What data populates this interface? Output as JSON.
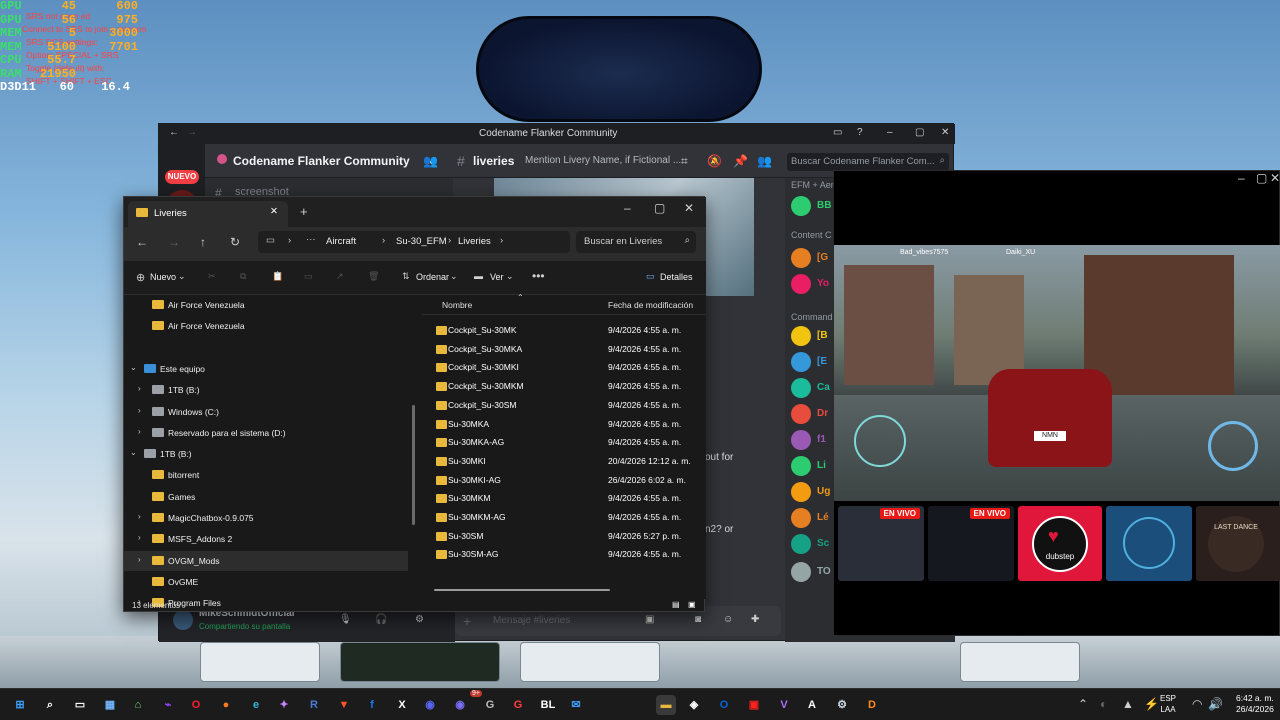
{
  "overlay": {
    "rows": [
      {
        "label": "GPU",
        "v1": "45",
        "v2": "600"
      },
      {
        "label": "GPU",
        "v1": "56",
        "v2": "975"
      },
      {
        "label": "MEM",
        "v1": "5",
        "v2": "3000"
      },
      {
        "label": "MEM",
        "v1": "5100",
        "v2": "7701"
      },
      {
        "label": "CPU",
        "v1": "55.7",
        "v2": ""
      },
      {
        "label": "RAM",
        "v1": "21950",
        "v2": ""
      }
    ],
    "fps_row": {
      "label": "D3D11",
      "fps": "60",
      "frametime": "16.4"
    },
    "dcs_lines": [
      "SRS not conn ed",
      "Connect to SRS to join a mission",
      "SRS DCS settings:",
      "Option: SPECIAL + SRS",
      "Toggle (default) with:",
      "SHIFT + SHIFT + ESC"
    ]
  },
  "discord": {
    "window_title": "Codename Flanker Community",
    "nuevo_badge": "NUEVO",
    "server_name": "Codename Flanker Community",
    "channel_name": "liveries",
    "channel_topic": "Mention Livery Name, if Fictional ...",
    "search_placeholder": "Buscar Codename Flanker Com...",
    "sidebar_channel": "screenshot",
    "member_categories": [
      "EFM + Aero",
      "Content C",
      "Command"
    ],
    "members": [
      "BB",
      "[G",
      "Yo",
      "[B",
      "[E",
      "Ca",
      "Dr",
      "f1",
      "Li",
      "Ug",
      "Lé",
      "Sc",
      "TO"
    ],
    "message_fragments": [
      "out for",
      "n2? or"
    ],
    "input_placeholder": "Mensaje #liveries",
    "user_name": "MikeSchmidtOfficial",
    "user_status": "Compartiendo su pantalla"
  },
  "stream": {
    "hud_names": [
      "Bad_vibes7575",
      "Daiki_XU"
    ],
    "plate": "NMN",
    "thumbnails": [
      {
        "live": "EN VIVO",
        "color": "#2a2e38"
      },
      {
        "live": "EN VIVO",
        "color": "#15181f"
      },
      {
        "text": "dubstep",
        "color": "#e0163a"
      },
      {
        "color": "#1b4e7a"
      },
      {
        "text": "LAST DANCE",
        "color": "#2a1f1c"
      }
    ]
  },
  "explorer": {
    "tab_title": "Liveries",
    "path": [
      "Aircraft",
      "Su-30_EFM",
      "Liveries"
    ],
    "search_placeholder": "Buscar en Liveries",
    "toolbar": {
      "new": "Nuevo",
      "sort": "Ordenar",
      "view": "Ver",
      "details": "Detalles"
    },
    "nav": [
      {
        "label": "Air Force Venezuela",
        "indent": 1,
        "icon": "folder",
        "chev": ""
      },
      {
        "label": "Air Force Venezuela",
        "indent": 1,
        "icon": "folder",
        "chev": ""
      },
      {
        "label": "",
        "indent": 0,
        "icon": "",
        "chev": ""
      },
      {
        "label": "Este equipo",
        "indent": 0,
        "icon": "pc",
        "chev": "⌄"
      },
      {
        "label": "1TB (B:)",
        "indent": 1,
        "icon": "drive",
        "chev": "›"
      },
      {
        "label": "Windows (C:)",
        "indent": 1,
        "icon": "drive",
        "chev": "›"
      },
      {
        "label": "Reservado para el sistema (D:)",
        "indent": 1,
        "icon": "drive",
        "chev": "›"
      },
      {
        "label": "1TB (B:)",
        "indent": 0,
        "icon": "drive",
        "chev": "⌄"
      },
      {
        "label": "bitorrent",
        "indent": 1,
        "icon": "folder",
        "chev": ""
      },
      {
        "label": "Games",
        "indent": 1,
        "icon": "folder",
        "chev": ""
      },
      {
        "label": "MagicChatbox-0.9.075",
        "indent": 1,
        "icon": "folder",
        "chev": "›"
      },
      {
        "label": "MSFS_Addons 2",
        "indent": 1,
        "icon": "folder",
        "chev": "›"
      },
      {
        "label": "OVGM_Mods",
        "indent": 1,
        "icon": "folder",
        "chev": "›",
        "selected": true
      },
      {
        "label": "OvGME",
        "indent": 1,
        "icon": "folder",
        "chev": ""
      },
      {
        "label": "Program Files",
        "indent": 1,
        "icon": "folder",
        "chev": "›"
      }
    ],
    "columns": {
      "name": "Nombre",
      "date": "Fecha de modificación"
    },
    "files": [
      {
        "name": "Cockpit_Su-30MK",
        "date": "9/4/2026 4:55 a. m."
      },
      {
        "name": "Cockpit_Su-30MKA",
        "date": "9/4/2026 4:55 a. m."
      },
      {
        "name": "Cockpit_Su-30MKI",
        "date": "9/4/2026 4:55 a. m."
      },
      {
        "name": "Cockpit_Su-30MKM",
        "date": "9/4/2026 4:55 a. m."
      },
      {
        "name": "Cockpit_Su-30SM",
        "date": "9/4/2026 4:55 a. m."
      },
      {
        "name": "Su-30MKA",
        "date": "9/4/2026 4:55 a. m."
      },
      {
        "name": "Su-30MKA-AG",
        "date": "9/4/2026 4:55 a. m."
      },
      {
        "name": "Su-30MKI",
        "date": "20/4/2026 12:12 a. m."
      },
      {
        "name": "Su-30MKI-AG",
        "date": "26/4/2026 6:02 a. m."
      },
      {
        "name": "Su-30MKM",
        "date": "9/4/2026 4:55 a. m."
      },
      {
        "name": "Su-30MKM-AG",
        "date": "9/4/2026 4:55 a. m."
      },
      {
        "name": "Su-30SM",
        "date": "9/4/2026 5:27 p. m."
      },
      {
        "name": "Su-30SM-AG",
        "date": "9/4/2026 4:55 a. m."
      }
    ],
    "status": "13 elementos"
  },
  "taskbar": {
    "lang": [
      "ESP",
      "LAA"
    ],
    "time": "6:42 a. m.",
    "date": "26/4/2026",
    "badge": "9+",
    "apps": [
      {
        "name": "start-icon",
        "glyph": "⊞",
        "color": "#3aa0ff"
      },
      {
        "name": "search-icon",
        "glyph": "⌕",
        "color": "#ffffff"
      },
      {
        "name": "task-view-icon",
        "glyph": "▭",
        "color": "#ffffff"
      },
      {
        "name": "widgets-icon",
        "glyph": "▦",
        "color": "#6fb6ff"
      },
      {
        "name": "app-icon",
        "glyph": "⌂",
        "color": "#7ad67a"
      },
      {
        "name": "twitch-icon",
        "glyph": "⌁",
        "color": "#9146ff"
      },
      {
        "name": "opera-icon",
        "glyph": "O",
        "color": "#ff1b2d"
      },
      {
        "name": "firefox-icon",
        "glyph": "●",
        "color": "#ff7b1c"
      },
      {
        "name": "edge-icon",
        "glyph": "e",
        "color": "#2fb8d8"
      },
      {
        "name": "copilot-icon",
        "glyph": "✦",
        "color": "#c586ff"
      },
      {
        "name": "r-icon",
        "glyph": "R",
        "color": "#4a7bd8"
      },
      {
        "name": "brave-icon",
        "glyph": "▼",
        "color": "#fb542b"
      },
      {
        "name": "facebook-icon",
        "glyph": "f",
        "color": "#1877f2"
      },
      {
        "name": "x-icon",
        "glyph": "X",
        "color": "#ffffff"
      },
      {
        "name": "discord-icon",
        "glyph": "◉",
        "color": "#5865f2"
      },
      {
        "name": "discord-ptb-icon",
        "glyph": "◉",
        "color": "#7a6cf5"
      },
      {
        "name": "g-icon",
        "glyph": "G",
        "color": "#bbbbbb"
      },
      {
        "name": "gx-icon",
        "glyph": "G",
        "color": "#ff3e3e"
      },
      {
        "name": "bl-icon",
        "glyph": "BL",
        "color": "#ffffff"
      },
      {
        "name": "mail-icon",
        "glyph": "✉",
        "color": "#3aa0ff"
      },
      {
        "name": "explorer-icon",
        "glyph": "▬",
        "color": "#e8b93b"
      },
      {
        "name": "store-icon",
        "glyph": "◈",
        "color": "#ffffff"
      },
      {
        "name": "outlook-icon",
        "glyph": "O",
        "color": "#0a64d8"
      },
      {
        "name": "mission-icon",
        "glyph": "▣",
        "color": "#ff2020"
      },
      {
        "name": "vs-icon",
        "glyph": "V",
        "color": "#a371f7"
      },
      {
        "name": "a-icon",
        "glyph": "A",
        "color": "#ffffff"
      },
      {
        "name": "steam-icon",
        "glyph": "⚙",
        "color": "#c7d5e0"
      },
      {
        "name": "dcs-icon",
        "glyph": "D",
        "color": "#ff8a1c"
      }
    ]
  }
}
